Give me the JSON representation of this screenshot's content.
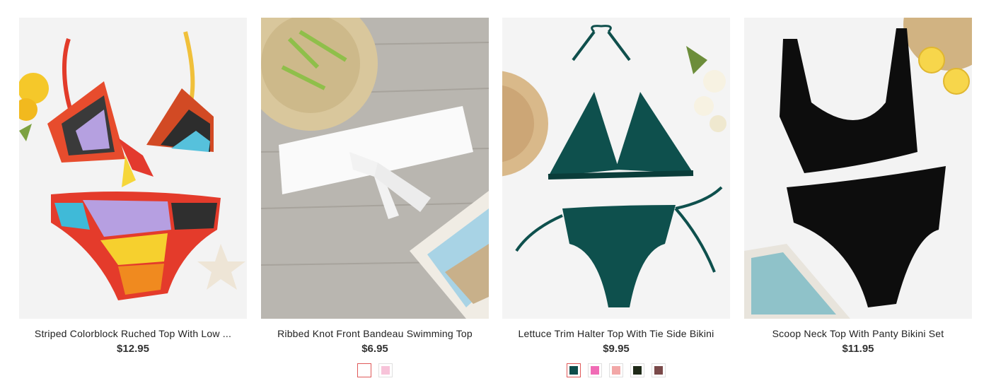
{
  "products": [
    {
      "title": "Striped Colorblock Ruched Top With Low ...",
      "price": "$12.95",
      "image_icon": "striped-bikini-photo",
      "swatches": []
    },
    {
      "title": "Ribbed Knot Front Bandeau Swimming Top",
      "price": "$6.95",
      "image_icon": "white-bandeau-photo",
      "swatches": [
        {
          "color": "#ffffff",
          "selected": true,
          "name": "white"
        },
        {
          "color": "#f7c3d9",
          "selected": false,
          "name": "pink"
        }
      ]
    },
    {
      "title": "Lettuce Trim Halter Top With Tie Side Bikini",
      "price": "$9.95",
      "image_icon": "green-halter-bikini-photo",
      "swatches": [
        {
          "color": "#0e4d4b",
          "selected": true,
          "name": "dark-green"
        },
        {
          "color": "#f06bb5",
          "selected": false,
          "name": "hot-pink"
        },
        {
          "color": "#f2a7a7",
          "selected": false,
          "name": "light-pink"
        },
        {
          "color": "#1f2a18",
          "selected": false,
          "name": "dark-olive"
        },
        {
          "color": "#7a4a4a",
          "selected": false,
          "name": "brown"
        }
      ]
    },
    {
      "title": "Scoop Neck Top With Panty Bikini Set",
      "price": "$11.95",
      "image_icon": "black-bikini-photo",
      "swatches": []
    }
  ]
}
